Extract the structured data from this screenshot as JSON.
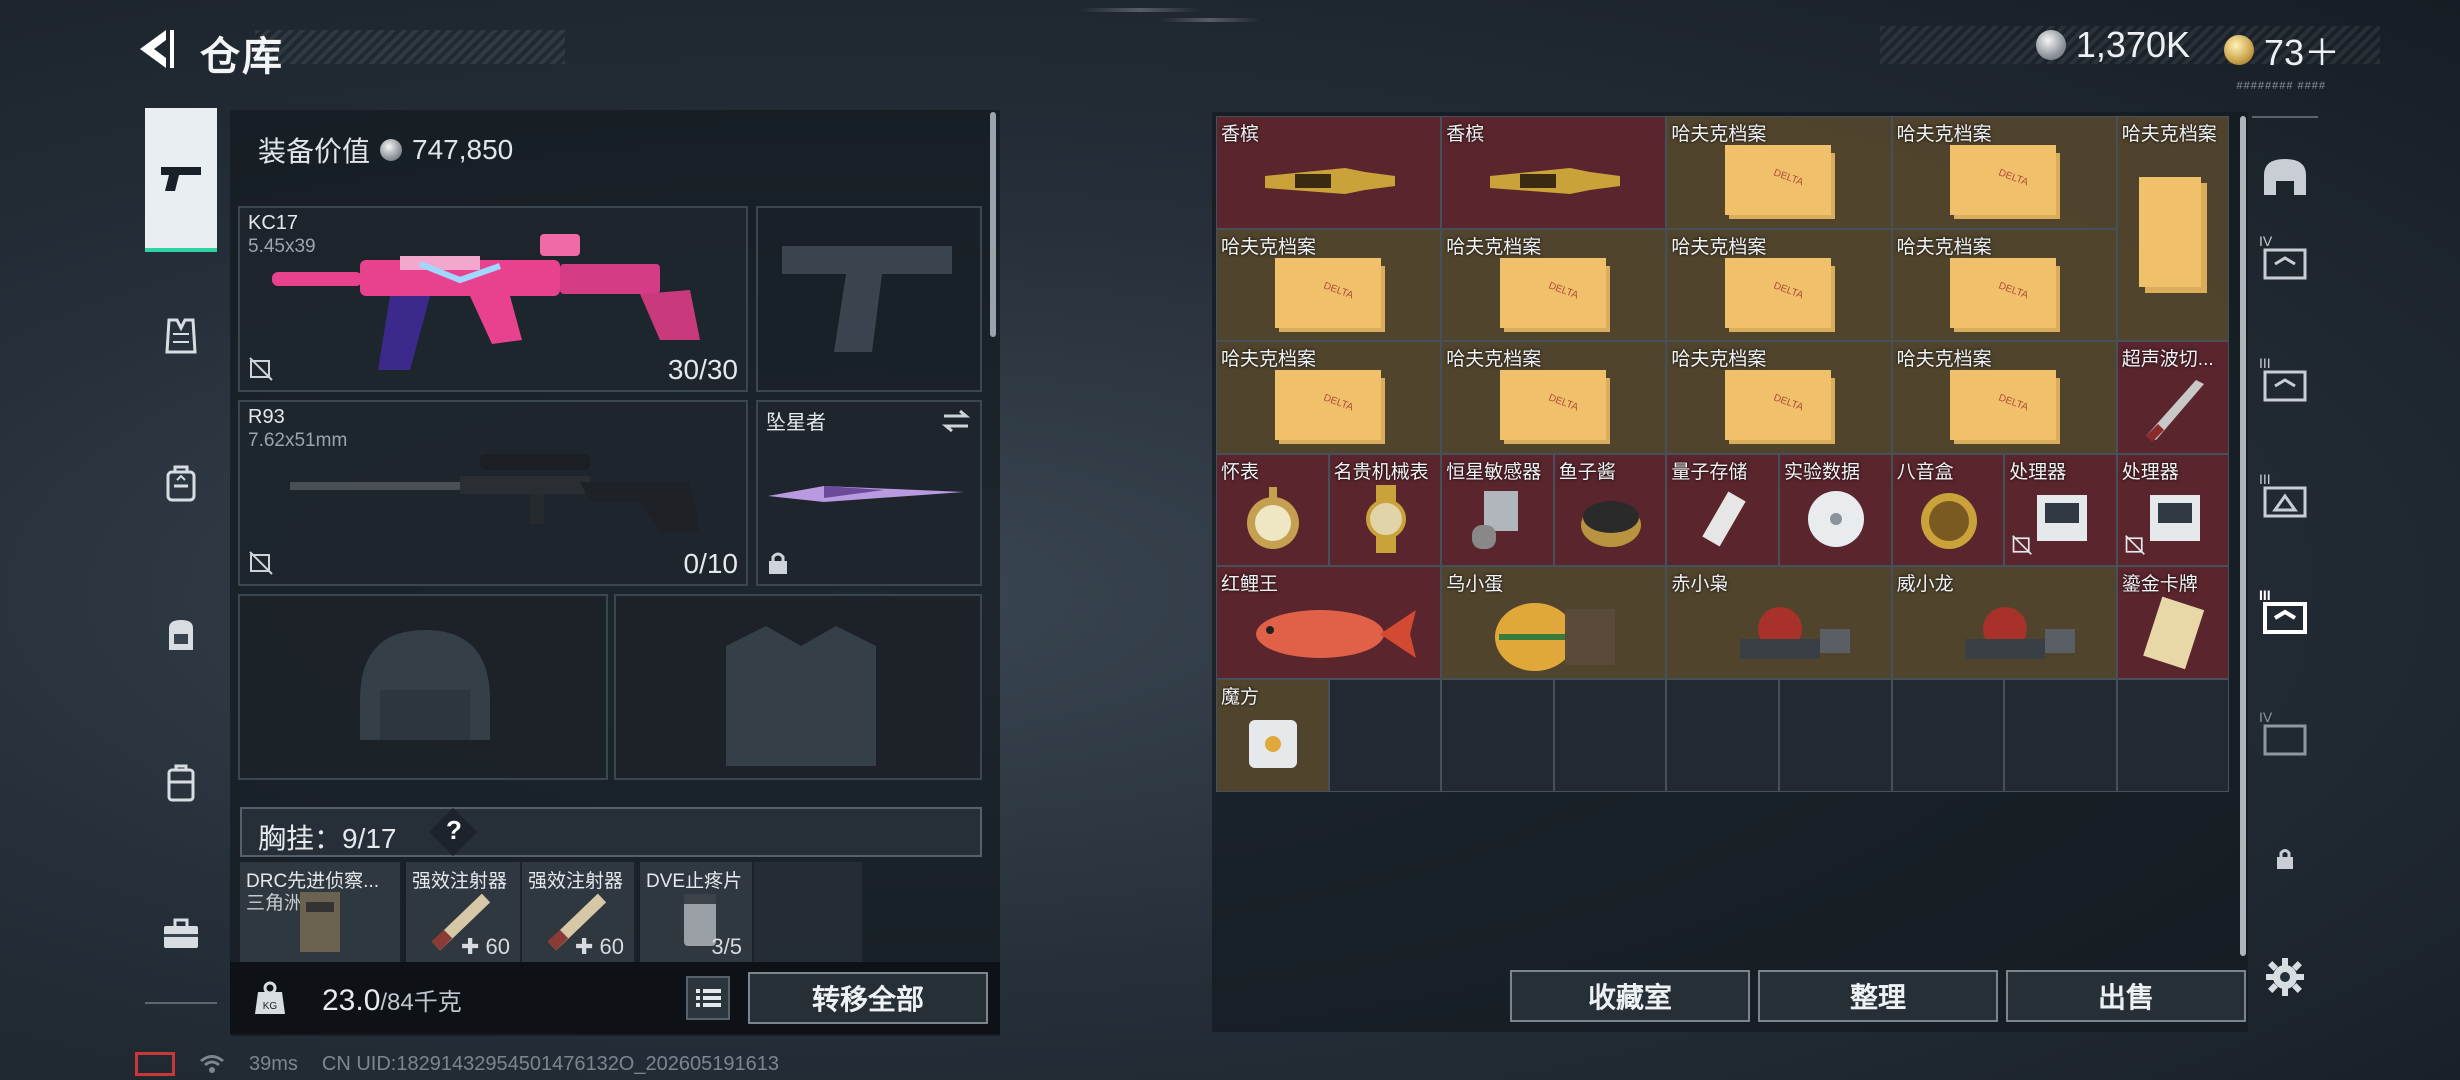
{
  "header": {
    "title": "仓库",
    "currency_silver": "1,370K",
    "currency_gold": "73＋",
    "version": "######## ####"
  },
  "left": {
    "equip_label": "装备价值",
    "equip_value": "747,850",
    "weapon1": {
      "name": "KC17",
      "caliber": "5.45x39",
      "ammo": "30/30"
    },
    "weapon2": {
      "name": "R93",
      "caliber": "7.62x51mm",
      "ammo": "0/10"
    },
    "melee": {
      "name": "坠星者"
    },
    "chest_label": "胸挂：9/17",
    "chest_help": "?",
    "chest_items": [
      {
        "name": "DRC先进侦察...",
        "sub": "三角洲",
        "qty": ""
      },
      {
        "name": "强效注射器",
        "sub": "",
        "qty": "60"
      },
      {
        "name": "强效注射器",
        "sub": "",
        "qty": "60"
      },
      {
        "name": "DVE止疼片",
        "sub": "",
        "qty": "3/5"
      }
    ],
    "weight": "23.0",
    "weight_max": "/84千克",
    "transfer_label": "转移全部"
  },
  "grid_items": [
    {
      "name": "香槟"
    },
    {
      "name": "香槟"
    },
    {
      "name": "哈夫克档案"
    },
    {
      "name": "哈夫克档案"
    },
    {
      "name": "哈夫克档案"
    },
    {
      "name": "哈夫克档案"
    },
    {
      "name": "哈夫克档案"
    },
    {
      "name": "哈夫克档案"
    },
    {
      "name": "哈夫克档案"
    },
    {
      "name": "哈夫克档案"
    },
    {
      "name": "哈夫克档案"
    },
    {
      "name": "哈夫克档案"
    },
    {
      "name": "哈夫克档案"
    },
    {
      "name": "超声波切..."
    },
    {
      "name": "怀表"
    },
    {
      "name": "名贵机械表"
    },
    {
      "name": "恒星敏感器"
    },
    {
      "name": "鱼子酱"
    },
    {
      "name": "量子存储"
    },
    {
      "name": "实验数据"
    },
    {
      "name": "八音盒"
    },
    {
      "name": "处理器"
    },
    {
      "name": "处理器"
    },
    {
      "name": "红鲤王"
    },
    {
      "name": "乌小蛋"
    },
    {
      "name": "赤小枭"
    },
    {
      "name": "威小龙"
    },
    {
      "name": "鎏金卡牌"
    },
    {
      "name": "魔方"
    }
  ],
  "actions": {
    "collection": "收藏室",
    "sort": "整理",
    "sell": "出售"
  },
  "right_sidebar": {
    "tier_labels": [
      "IV",
      "III",
      "III",
      "III",
      "IV"
    ]
  },
  "status": {
    "ping": "39ms",
    "uid": "CN UID:18291432954501476132O_202605191613"
  },
  "colors": {
    "accent_green": "#2fd3a2",
    "red_rarity": "#6e2630",
    "gold_rarity": "#604e30",
    "weapon_pink": "#e8428f"
  }
}
